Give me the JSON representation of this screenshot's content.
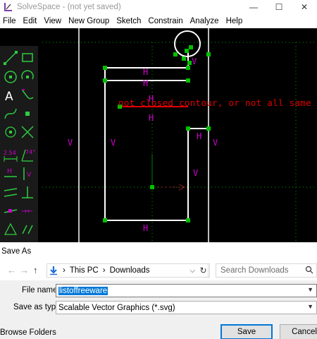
{
  "window": {
    "title": "SolveSpace - (not yet saved)",
    "minimize": "—",
    "maximize": "☐",
    "close": "✕"
  },
  "menu": [
    "File",
    "Edit",
    "View",
    "New Group",
    "Sketch",
    "Constrain",
    "Analyze",
    "Help"
  ],
  "canvas": {
    "error_message": "not closed contour, or not all same style!",
    "constraint_labels": [
      "H",
      "H",
      "H",
      "H",
      "H",
      "H",
      "V",
      "V",
      "V",
      "V",
      "V"
    ],
    "colors": {
      "background": "#000000",
      "lines": "#ffffff",
      "points": "#00c000",
      "constraints": "#d000d0",
      "error": "#e00000",
      "axis_dots": "#00a000"
    }
  },
  "toolbar": {
    "tools": [
      "line-tool-icon",
      "rectangle-tool-icon",
      "circle-tool-icon",
      "arc-tool-icon",
      "text-tool-icon",
      "tangent-arc-tool-icon",
      "bezier-tool-icon",
      "point-tool-icon",
      "construction-tool-icon",
      "split-curves-tool-icon",
      "distance-constraint-icon",
      "angle-constraint-icon",
      "horizontal-constraint-icon",
      "vertical-constraint-icon",
      "parallel-constraint-icon",
      "perpendicular-constraint-icon",
      "on-point-constraint-icon",
      "symmetric-constraint-icon",
      "midpoint-constraint-icon",
      "equal-constraint-icon"
    ],
    "labels": {
      "distance": "2.54",
      "angle": "74°",
      "horizontal": "H",
      "vertical": "V"
    }
  },
  "dialog": {
    "title": "Save As",
    "breadcrumb": [
      "This PC",
      "Downloads"
    ],
    "search_placeholder": "Search Downloads",
    "file_name_label": "File name:",
    "file_name_value": "listoffreeware",
    "save_type_label": "Save as type:",
    "save_type_value": "Scalable Vector Graphics (*.svg)",
    "browse_folders": "Browse Folders",
    "save_button": "Save",
    "cancel_button": "Cancel"
  }
}
